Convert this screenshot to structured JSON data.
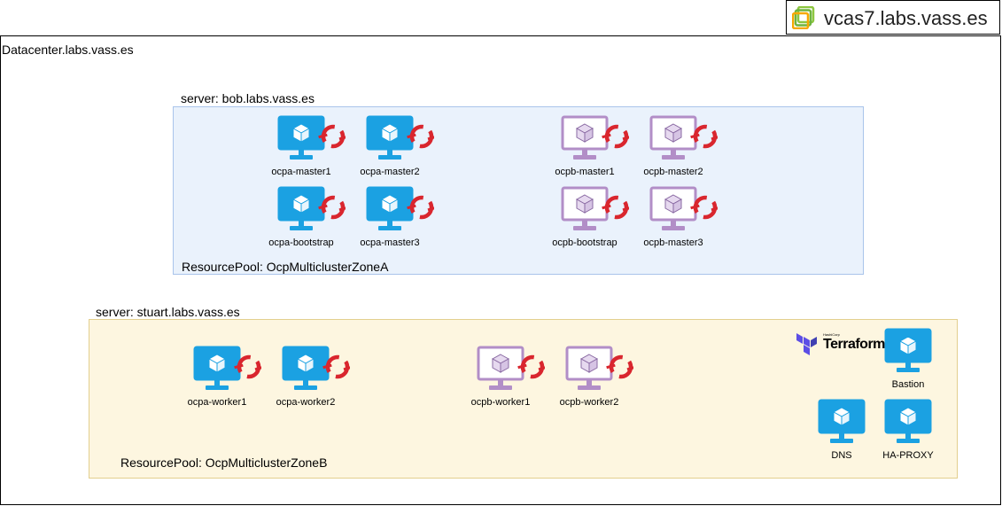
{
  "vcenter": {
    "label": "vcas7.labs.vass.es",
    "icon": "vsphere-icon"
  },
  "datacenter": {
    "label": "Datacenter.labs.vass.es"
  },
  "servers": [
    {
      "label": "server: bob.labs.vass.es",
      "resource_pool": "ResourcePool: OcpMulticlusterZoneA",
      "vms": [
        {
          "name": "ocpa-master1",
          "type": "ocpa"
        },
        {
          "name": "ocpa-master2",
          "type": "ocpa"
        },
        {
          "name": "ocpb-master1",
          "type": "ocpb"
        },
        {
          "name": "ocpb-master2",
          "type": "ocpb"
        },
        {
          "name": "ocpa-bootstrap",
          "type": "ocpa"
        },
        {
          "name": "ocpa-master3",
          "type": "ocpa"
        },
        {
          "name": "ocpb-bootstrap",
          "type": "ocpb"
        },
        {
          "name": "ocpb-master3",
          "type": "ocpb"
        }
      ]
    },
    {
      "label": "server: stuart.labs.vass.es",
      "resource_pool": "ResourcePool: OcpMulticlusterZoneB",
      "vms": [
        {
          "name": "ocpa-worker1",
          "type": "ocpa"
        },
        {
          "name": "ocpa-worker2",
          "type": "ocpa"
        },
        {
          "name": "ocpb-worker1",
          "type": "ocpb"
        },
        {
          "name": "ocpb-worker2",
          "type": "ocpb"
        }
      ],
      "infra_vms": [
        {
          "name": "Bastion"
        },
        {
          "name": "DNS"
        },
        {
          "name": "HA-PROXY"
        }
      ]
    }
  ],
  "terraform": {
    "label": "Terraform",
    "vendor": "HashiCorp",
    "icon": "terraform-icon"
  },
  "colors": {
    "ocpa_monitor": "#1ba1e2",
    "ocpb_monitor": "#b28ec7",
    "openshift_red": "#d9262e",
    "terraform_purple": "#5c4ee5"
  }
}
